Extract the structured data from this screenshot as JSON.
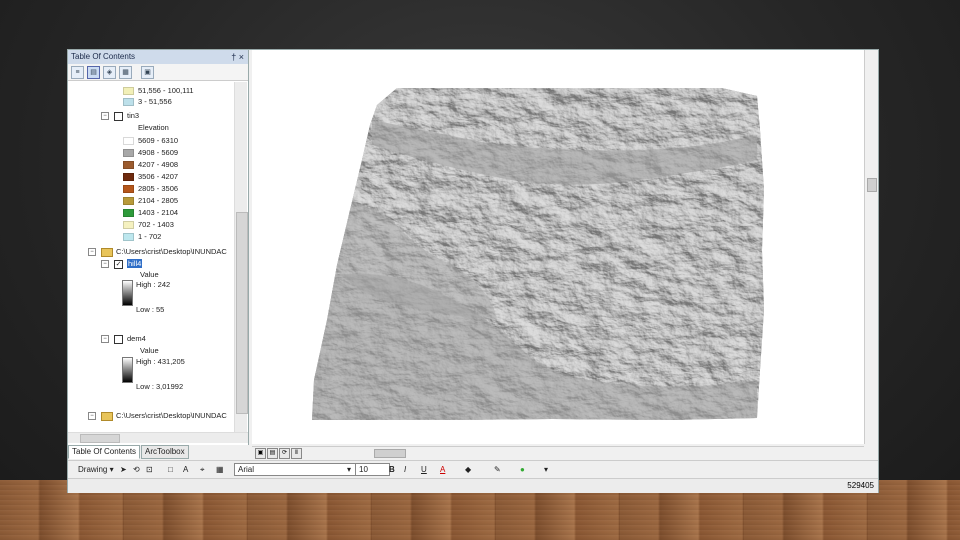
{
  "window": {
    "toc_title": "Table Of Contents",
    "toc_title_controls": "† ×"
  },
  "toc_toolbar": {
    "icons": [
      "list-by-drawing-order-icon",
      "list-by-source-icon",
      "list-by-visibility-icon",
      "list-by-selection-icon",
      "options-icon"
    ]
  },
  "toc": {
    "items": [
      {
        "label": "51,556 - 100,111",
        "color": "#f2f0b8"
      },
      {
        "label": "3 - 51,556",
        "color": "#bde0ea"
      },
      {
        "label": "tin3"
      },
      {
        "label": "Elevation"
      },
      {
        "label": "5609 - 6310",
        "color": "#ffffff"
      },
      {
        "label": "4908 - 5609",
        "color": "#a8a8a8"
      },
      {
        "label": "4207 - 4908",
        "color": "#9b5b2e"
      },
      {
        "label": "3506 - 4207",
        "color": "#6e2a0e"
      },
      {
        "label": "2805 - 3506",
        "color": "#b5561b"
      },
      {
        "label": "2104 - 2805",
        "color": "#b89a3a"
      },
      {
        "label": "1403 - 2104",
        "color": "#2e9a3a"
      },
      {
        "label": "702 - 1403",
        "color": "#f5f1c0"
      },
      {
        "label": "1 - 702",
        "color": "#bde7ee"
      },
      {
        "label": "C:\\Users\\crist\\Desktop\\INUNDAC"
      },
      {
        "label": "hill4"
      },
      {
        "label": "Value"
      },
      {
        "label": "High : 242"
      },
      {
        "label": "Low : 55"
      },
      {
        "label": "dem4"
      },
      {
        "label": "Value"
      },
      {
        "label": "High : 431,205"
      },
      {
        "label": "Low : 3,01992"
      },
      {
        "label": "C:\\Users\\crist\\Desktop\\INUNDAC"
      }
    ]
  },
  "tabs": [
    {
      "label": "Table Of Contents"
    },
    {
      "label": "ArcToolbox"
    }
  ],
  "drawing_toolbar": {
    "drawing_label": "Drawing ▾",
    "font_name": "Arial",
    "font_size": "10",
    "bold": "B",
    "italic": "I",
    "underline": "U",
    "font_color_label": "A"
  },
  "status": {
    "coordinates": "529405"
  },
  "colors": {
    "selection": "#2f6ec7",
    "panel_title": "#cfdbeb"
  }
}
